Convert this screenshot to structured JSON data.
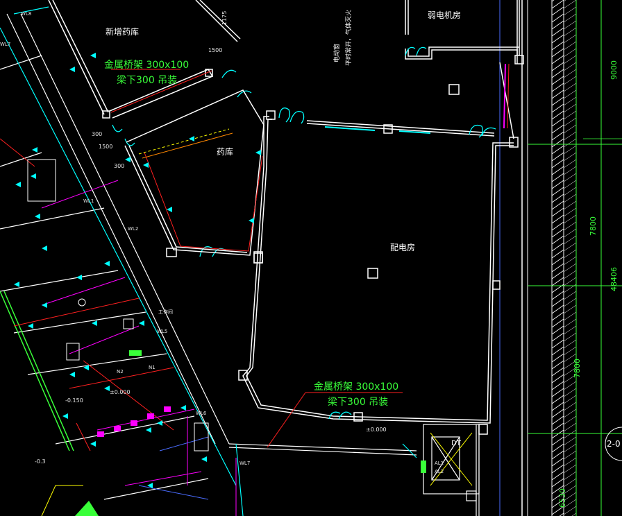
{
  "rooms": {
    "weak_room": "弱电机房",
    "new_pharmacy": "新增药库",
    "pharmacy": "药库",
    "power_room": "配电房"
  },
  "tray_note_1": {
    "line1": "金属桥架  300x100",
    "line2": "梁下300 吊装"
  },
  "tray_note_2": {
    "line1": "金属桥架  300x100",
    "line2": "梁下300 吊装"
  },
  "vertical_note_1": "电动窗",
  "vertical_note_2": "平时常开，气体灭火",
  "dims": {
    "d9000": "9000",
    "d7800a": "7800",
    "d48406": "48406",
    "d7800b": "7800",
    "d6530": "6530",
    "d1175": "1175",
    "d1500": "1500",
    "d300": "300",
    "d1500b": "1500",
    "d300b": "300",
    "axis": "2-0"
  },
  "small_labels": {
    "wl_top": "WL8",
    "wl7": "WL7",
    "wl6": "WL6",
    "wl5": "WL5",
    "wl2": "WL2",
    "wl1": "WL1",
    "wl7b": "WL7",
    "level_a": "±0.000",
    "level_b": "±0.000",
    "level_c": "-0.150",
    "level_d": "-0.3",
    "dt": "DT",
    "al1": "AL1",
    "al2": "AL2",
    "n1": "N1",
    "n2": "N2",
    "gate": "工作间"
  },
  "colors": {
    "wall": "#ffffff",
    "cyan": "#00ffff",
    "green": "#39ff39",
    "red": "#ff2020",
    "magenta": "#ff00ff",
    "yellow": "#ffff00",
    "blue": "#4a6cff"
  }
}
